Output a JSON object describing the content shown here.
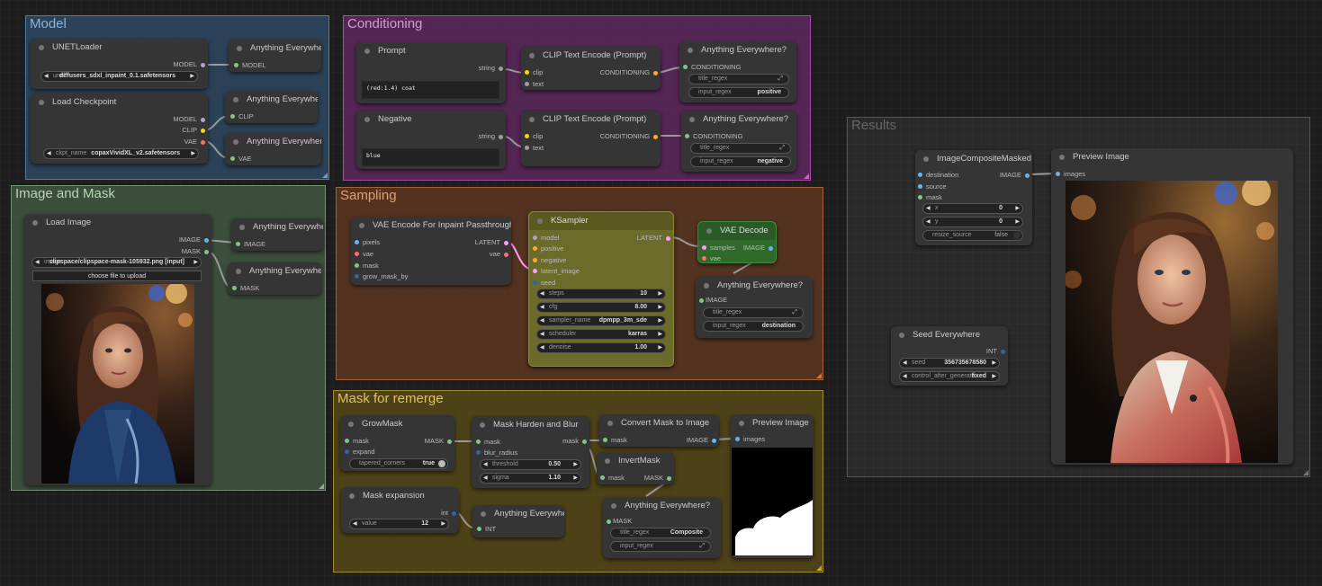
{
  "colors": {
    "clip": "#ffd500",
    "conditioning": "#ffa931",
    "model": "#b39ddb",
    "vae": "#ff6e6e",
    "image": "#64b5f6",
    "mask": "#81c784",
    "latent": "#ff9cf9",
    "int": "#29699c",
    "string": "#9e9e9e"
  },
  "groups": {
    "model": "Model",
    "conditioning": "Conditioning",
    "image_mask": "Image and Mask",
    "sampling": "Sampling",
    "mask_remerge": "Mask for remerge",
    "results": "Results"
  },
  "nodes": {
    "unet": {
      "title": "UNETLoader",
      "out_model": "MODEL",
      "w_label": "unet",
      "w_value": "diffusers_sdxl_inpaint_0.1.safetensors"
    },
    "ae1": {
      "title": "Anything Everywhere",
      "in": "MODEL"
    },
    "ckpt": {
      "title": "Load Checkpoint",
      "out_model": "MODEL",
      "out_clip": "CLIP",
      "out_vae": "VAE",
      "w_label": "ckpt_name",
      "w_value": "copaxVividXL_v2.safetensors"
    },
    "ae2": {
      "title": "Anything Everywhere",
      "in": "CLIP"
    },
    "ae3": {
      "title": "Anything Everywhere",
      "in": "VAE"
    },
    "prompt": {
      "title": "Prompt",
      "out": "string",
      "text": "(red:1.4) coat"
    },
    "negative": {
      "title": "Negative",
      "out": "string",
      "text": "blue"
    },
    "clip1": {
      "title": "CLIP Text Encode (Prompt)",
      "in_clip": "clip",
      "in_text": "text",
      "out": "CONDITIONING"
    },
    "clip2": {
      "title": "CLIP Text Encode (Prompt)",
      "in_clip": "clip",
      "in_text": "text",
      "out": "CONDITIONING"
    },
    "aeq1": {
      "title": "Anything Everywhere?",
      "in": "CONDITIONING",
      "w1_label": "title_regex",
      "w2_label": "input_regex",
      "w2_value": "positive"
    },
    "aeq2": {
      "title": "Anything Everywhere?",
      "in": "CONDITIONING",
      "w1_label": "title_regex",
      "w2_label": "input_regex",
      "w2_value": "negative"
    },
    "loadimg": {
      "title": "Load Image",
      "out_image": "IMAGE",
      "out_mask": "MASK",
      "w_label": "image",
      "w_value": "clipspace/clipspace-mask-105932.png [input]",
      "button": "choose file to upload"
    },
    "ae4": {
      "title": "Anything Everywhere",
      "in": "IMAGE"
    },
    "ae5": {
      "title": "Anything Everywhere",
      "in": "MASK"
    },
    "vaeenc": {
      "title": "VAE Encode For Inpaint Passthrough",
      "in1": "pixels",
      "in2": "vae",
      "in3": "mask",
      "in4": "grow_mask_by",
      "out1": "LATENT",
      "out2": "vae"
    },
    "ksampler": {
      "title": "KSampler",
      "in1": "model",
      "in2": "positive",
      "in3": "negative",
      "in4": "latent_image",
      "in5": "seed",
      "out": "LATENT",
      "widgets": [
        {
          "label": "steps",
          "value": "10"
        },
        {
          "label": "cfg",
          "value": "8.00"
        },
        {
          "label": "sampler_name",
          "value": "dpmpp_3m_sde"
        },
        {
          "label": "scheduler",
          "value": "karras"
        },
        {
          "label": "denoise",
          "value": "1.00"
        }
      ]
    },
    "vaedec": {
      "title": "VAE Decode",
      "in1": "samples",
      "in2": "vae",
      "out": "IMAGE"
    },
    "aeq3": {
      "title": "Anything Everywhere?",
      "in": "IMAGE",
      "w1_label": "title_regex",
      "w2_label": "input_regex",
      "w2_value": "destination"
    },
    "growmask": {
      "title": "GrowMask",
      "in1": "mask",
      "in2": "expand",
      "out": "MASK",
      "w_label": "tapered_corners",
      "w_value": "true"
    },
    "harden": {
      "title": "Mask Harden and Blur",
      "in1": "mask",
      "in2": "blur_radius",
      "out": "mask",
      "w1_label": "threshold",
      "w1_value": "0.50",
      "w2_label": "sigma",
      "w2_value": "1.10"
    },
    "convert": {
      "title": "Convert Mask to Image",
      "in": "mask",
      "out": "IMAGE"
    },
    "invert": {
      "title": "InvertMask",
      "in": "mask",
      "out": "MASK"
    },
    "preview1": {
      "title": "Preview Image",
      "in": "images"
    },
    "maskexp": {
      "title": "Mask expansion",
      "out": "int",
      "w_label": "value",
      "w_value": "12"
    },
    "ae6": {
      "title": "Anything Everywhere",
      "in": "INT"
    },
    "aeq4": {
      "title": "Anything Everywhere?",
      "in": "MASK",
      "w1_label": "title_regex",
      "w1_value": "Composite",
      "w2_label": "input_regex"
    },
    "composite": {
      "title": "ImageCompositeMasked",
      "in1": "destination",
      "in2": "source",
      "in3": "mask",
      "out": "IMAGE",
      "w1_label": "x",
      "w1_value": "0",
      "w2_label": "y",
      "w2_value": "0",
      "w3_label": "resize_source",
      "w3_value": "false"
    },
    "preview2": {
      "title": "Preview Image",
      "in": "images"
    },
    "seed": {
      "title": "Seed Everywhere",
      "out": "INT",
      "w1_label": "seed",
      "w1_value": "356735678580",
      "w2_label": "control_after_generate",
      "w2_value": "fixed"
    }
  }
}
